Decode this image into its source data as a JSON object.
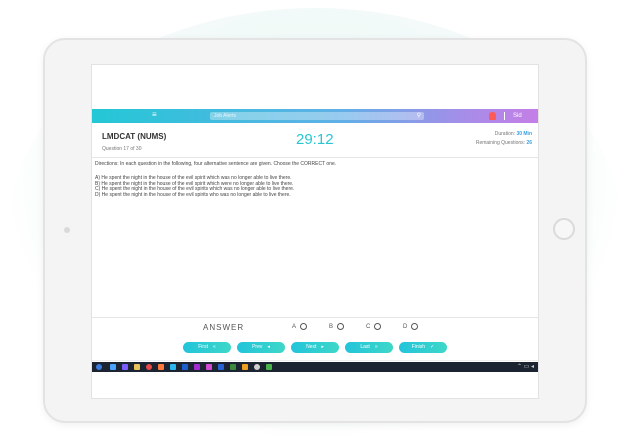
{
  "navbar": {
    "search_placeholder": "Job Alerts",
    "user_label": "Sid"
  },
  "exam": {
    "title": "LMDCAT (NUMS)",
    "question_counter": "Question 17 of 30",
    "timer": "29:12",
    "duration_label": "Duration: ",
    "duration_value": "30 Min",
    "remaining_label": "Remaining Questions: ",
    "remaining_value": "26",
    "directions": "Directions: In each question in the following, four alternative sentence are given. Choose the CORRECT one.",
    "options": [
      "A) He spent the night in the house of the evil spirit which was no longer able to live there.",
      "B) He spent the night in the house of the evil spirit which were no longer able to live there.",
      "C) He spent the night in the house of the evil spirits which was no longer able to live there.",
      "D) He spent the night in the house of the evil spirits who was no longer able to live there."
    ]
  },
  "answer": {
    "label": "ANSWER",
    "choices": [
      "A",
      "B",
      "C",
      "D"
    ]
  },
  "buttons": {
    "first": "First",
    "prev": "Prev",
    "next": "Next",
    "last": "Last",
    "finish": "Finish"
  },
  "icons": {
    "menu": "menu-icon",
    "search": "search-icon",
    "notification": "bell-icon",
    "first": "double-chevron-left-icon",
    "prev": "chevron-left-icon",
    "next": "chevron-right-icon",
    "last": "double-chevron-right-icon",
    "finish": "check-circle-icon"
  },
  "colors": {
    "accent": "#28c5d3",
    "button": "#22c4da",
    "nav_gradient_start": "#24c7d6",
    "nav_gradient_end": "#c47fe6",
    "taskbar": "#1c2331"
  }
}
